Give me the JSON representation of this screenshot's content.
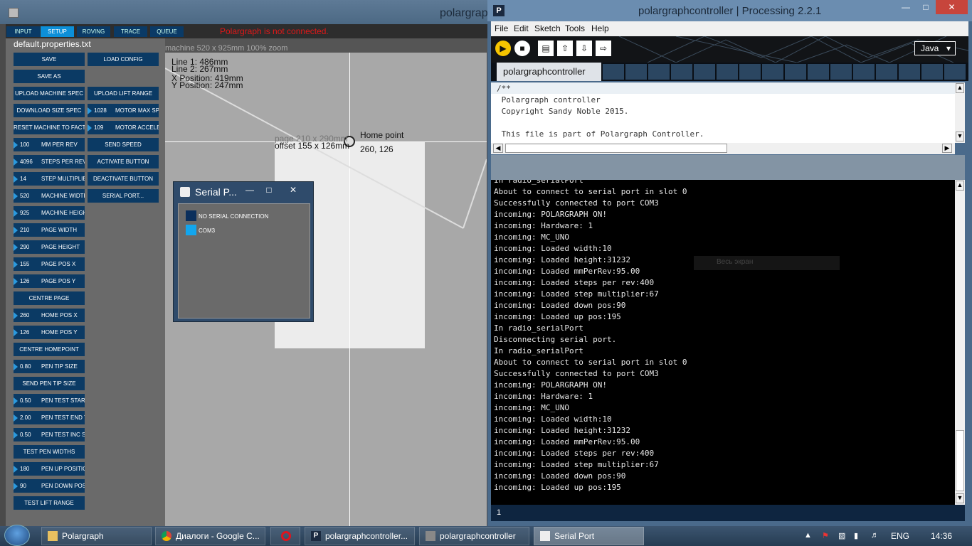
{
  "polargraph": {
    "title": "polargraph",
    "tabs": [
      "INPUT",
      "SETUP",
      "ROVING",
      "TRACE",
      "QUEUE"
    ],
    "status": "Polargraph is not connected.",
    "properties_file": "default.properties.txt",
    "machine_info": "machine 520 x 925mm 100% zoom",
    "buttons": {
      "save": "SAVE",
      "load_config": "LOAD CONFIG",
      "save_as": "SAVE AS",
      "upload_machine_spec": "UPLOAD MACHINE SPEC",
      "upload_lift_range": "UPLOAD LIFT RANGE",
      "download_size_spec": "DOWNLOAD SIZE SPEC",
      "reset_machine": "RESET MACHINE TO FACTORY",
      "send_speed": "SEND SPEED",
      "activate": "ACTIVATE BUTTON",
      "deactivate": "DEACTIVATE BUTTON",
      "serial_port": "SERIAL PORT...",
      "centre_page": "CENTRE PAGE",
      "centre_homepoint": "CENTRE HOMEPOINT",
      "send_pen_tip_size": "SEND PEN TIP SIZE",
      "test_pen_widths": "TEST PEN WIDTHS",
      "test_lift_range": "TEST LIFT RANGE"
    },
    "numbers": {
      "mm_per_rev": {
        "value": "100",
        "label": "MM PER REV"
      },
      "steps_per_rev": {
        "value": "4096",
        "label": "STEPS PER REV"
      },
      "step_multiplier": {
        "value": "14",
        "label": "STEP MULTIPLIER"
      },
      "machine_width": {
        "value": "520",
        "label": "MACHINE WIDTH"
      },
      "machine_height": {
        "value": "925",
        "label": "MACHINE HEIGHT"
      },
      "page_width": {
        "value": "210",
        "label": "PAGE WIDTH"
      },
      "page_height": {
        "value": "290",
        "label": "PAGE HEIGHT"
      },
      "page_pos_x": {
        "value": "155",
        "label": "PAGE POS X"
      },
      "page_pos_y": {
        "value": "126",
        "label": "PAGE POS Y"
      },
      "home_pos_x": {
        "value": "260",
        "label": "HOME POS X"
      },
      "home_pos_y": {
        "value": "126",
        "label": "HOME POS Y"
      },
      "pen_tip_size": {
        "value": "0.80",
        "label": "PEN TIP SIZE"
      },
      "pen_test_start": {
        "value": "0.50",
        "label": "PEN TEST START TIP"
      },
      "pen_test_end": {
        "value": "2.00",
        "label": "PEN TEST END TIP"
      },
      "pen_test_inc": {
        "value": "0.50",
        "label": "PEN TEST INC SIZE"
      },
      "pen_up": {
        "value": "180",
        "label": "PEN UP POSITION"
      },
      "pen_down": {
        "value": "90",
        "label": "PEN DOWN POSITION"
      },
      "motor_max_speed": {
        "value": "1028",
        "label": "MOTOR MAX SPEED"
      },
      "motor_accel": {
        "value": "109",
        "label": "MOTOR ACCELERATION"
      }
    },
    "canvas": {
      "line1": "Line 1: 486mm",
      "line2": "Line 2: 267mm",
      "xpos": "X Position: 419mm",
      "ypos": "Y Position: 247mm",
      "page_size": "page 210 x 290mm",
      "page_offset": "offset 155 x 126mm",
      "home_label": "Home point",
      "home_coords": "260, 126"
    }
  },
  "serial_dialog": {
    "title": "Serial P...",
    "options": [
      {
        "label": "NO SERIAL CONNECTION",
        "color": "#0b2f5c"
      },
      {
        "label": "COM3",
        "color": "#12a6ee"
      }
    ]
  },
  "processing": {
    "title": "polargraphcontroller | Processing 2.2.1",
    "menu": [
      "File",
      "Edit",
      "Sketch",
      "Tools",
      "Help"
    ],
    "mode": "Java",
    "tab": "polargraphcontroller",
    "code": [
      "/**",
      " Polargraph controller",
      " Copyright Sandy Noble 2015.",
      "",
      " This file is part of Polargraph Controller."
    ],
    "console": [
      "In radio_serialPort",
      "About to connect to serial port in slot 0",
      "Successfully connected to port COM3",
      "incoming: POLARGRAPH ON!",
      "incoming: Hardware: 1",
      "incoming: MC_UNO",
      "incoming: Loaded width:10",
      "incoming: Loaded height:31232",
      "incoming: Loaded mmPerRev:95.00",
      "incoming: Loaded steps per rev:400",
      "incoming: Loaded step multiplier:67",
      "incoming: Loaded down pos:90",
      "incoming: Loaded up pos:195",
      "In radio_serialPort",
      "Disconnecting serial port.",
      "In radio_serialPort",
      "About to connect to serial port in slot 0",
      "Successfully connected to port COM3",
      "incoming: POLARGRAPH ON!",
      "incoming: Hardware: 1",
      "incoming: MC_UNO",
      "incoming: Loaded width:10",
      "incoming: Loaded height:31232",
      "incoming: Loaded mmPerRev:95.00",
      "incoming: Loaded steps per rev:400",
      "incoming: Loaded step multiplier:67",
      "incoming: Loaded down pos:90",
      "incoming: Loaded up pos:195"
    ],
    "line_number": "1",
    "overlay": "Весь экран"
  },
  "taskbar": {
    "items": [
      "Polargraph",
      "Диалоги - Google C...",
      "polargraphcontroller...",
      "polargraphcontroller",
      "Serial Port"
    ],
    "lang": "ENG",
    "time": "14:36"
  }
}
